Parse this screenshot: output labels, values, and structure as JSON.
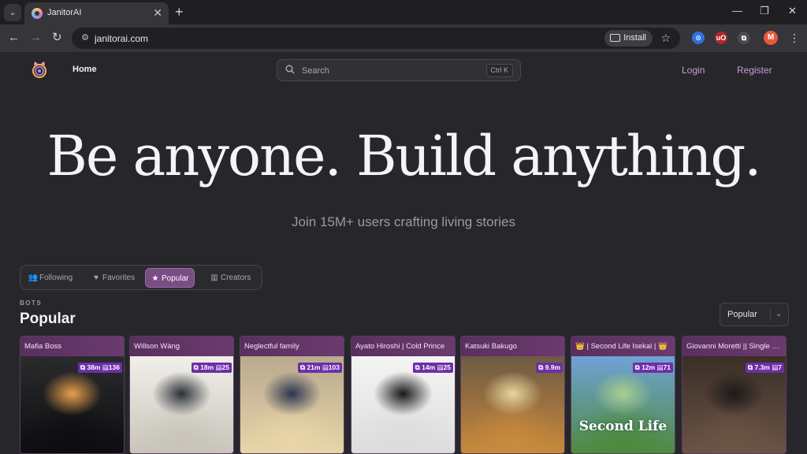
{
  "browser": {
    "tab_title": "JanitorAI",
    "tab_close": "✕",
    "new_tab": "+",
    "url": "janitorai.com",
    "install_label": "Install",
    "profile_initial": "M",
    "window_controls": [
      "—",
      "❐",
      "✕"
    ],
    "extensions": [
      {
        "name": "password-manager-extension-icon",
        "color": "#2f6fe0",
        "glyph": "⊙"
      },
      {
        "name": "ublock-extension-icon",
        "color": "#b3262f",
        "glyph": "uO"
      },
      {
        "name": "extensions-puzzle-icon",
        "color": "#4a4a50",
        "glyph": "⧉"
      }
    ]
  },
  "site": {
    "nav": {
      "home": "Home",
      "search_placeholder": "Search",
      "search_shortcut": "Ctrl K",
      "login": "Login",
      "register": "Register"
    },
    "hero": {
      "title": "Be anyone. Build anything.",
      "subtitle": "Join 15M+ users crafting living stories"
    },
    "filters": [
      {
        "label": "Following",
        "icon": "users-icon",
        "glyph": "👥",
        "active": false
      },
      {
        "label": "Favorites",
        "icon": "heart-icon",
        "glyph": "♥",
        "active": false
      },
      {
        "label": "Popular",
        "icon": "star-icon",
        "glyph": "★",
        "active": true
      },
      {
        "label": "Creators",
        "icon": "bar-chart-icon",
        "glyph": "▥",
        "active": false
      }
    ],
    "section": {
      "kicker": "BOTS",
      "title": "Popular",
      "sort": "Popular"
    },
    "accent_color": "#c99bd9",
    "bots": [
      {
        "name": "Mafia Boss",
        "chats": "38m",
        "messages": "136",
        "palette": [
          "#2b2b2e",
          "#0d0d0f",
          "#e8a04a"
        ]
      },
      {
        "name": "Willson Wàng",
        "chats": "18m",
        "messages": "25",
        "palette": [
          "#f1efe9",
          "#c8c4bb",
          "#2a2f36"
        ]
      },
      {
        "name": "Neglectful family",
        "chats": "21m",
        "messages": "103",
        "palette": [
          "#b9aa8f",
          "#e8d5a8",
          "#2c3650"
        ]
      },
      {
        "name": "Ayato Hiroshi | Cold Prince",
        "chats": "14m",
        "messages": "25",
        "palette": [
          "#f4f4f4",
          "#dcdcdc",
          "#161618"
        ]
      },
      {
        "name": "Katsuki Bakugo",
        "chats": "9.9m",
        "messages": "",
        "palette": [
          "#6d5a44",
          "#c98a3c",
          "#e9d6a0"
        ]
      },
      {
        "name": "👑 | Second Life Isekai | 👑",
        "chats": "12m",
        "messages": "71",
        "palette": [
          "#6fa2d6",
          "#4e8a3d",
          "#a8d08a"
        ],
        "overlay_text": "Second Life"
      },
      {
        "name": "Giovanni Moretti || Single Fath",
        "chats": "7.3m",
        "messages": "7",
        "palette": [
          "#3a2e28",
          "#6b5445",
          "#1c1a1a"
        ]
      }
    ]
  }
}
